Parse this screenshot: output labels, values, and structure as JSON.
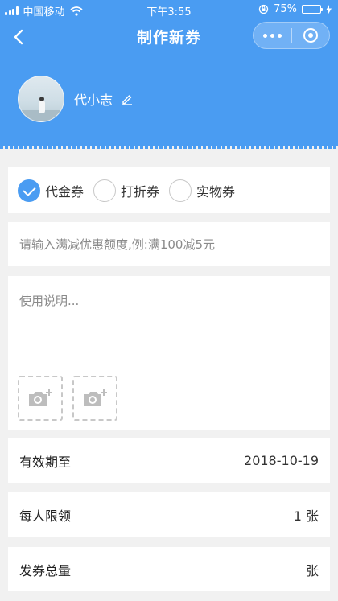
{
  "status_bar": {
    "carrier": "中国移动",
    "time": "下午3:55",
    "battery": "75%",
    "battery_level": 0.75
  },
  "nav": {
    "title": "制作新券"
  },
  "profile": {
    "name": "代小志"
  },
  "coupon_types": [
    {
      "label": "代金券",
      "checked": true
    },
    {
      "label": "打折券",
      "checked": false
    },
    {
      "label": "实物券",
      "checked": false
    }
  ],
  "discount_input": {
    "placeholder": "请输入满减优惠额度,例:满100减5元",
    "value": ""
  },
  "description": {
    "placeholder": "使用说明...",
    "value": ""
  },
  "rows": {
    "valid_until": {
      "label": "有效期至",
      "value": "2018-10-19"
    },
    "limit_per_person": {
      "label": "每人限领",
      "value": "1 张"
    },
    "total_quantity": {
      "label": "发券总量",
      "value": "张"
    }
  },
  "colors": {
    "primary": "#4a9cf2",
    "background": "#f1f1f1"
  }
}
